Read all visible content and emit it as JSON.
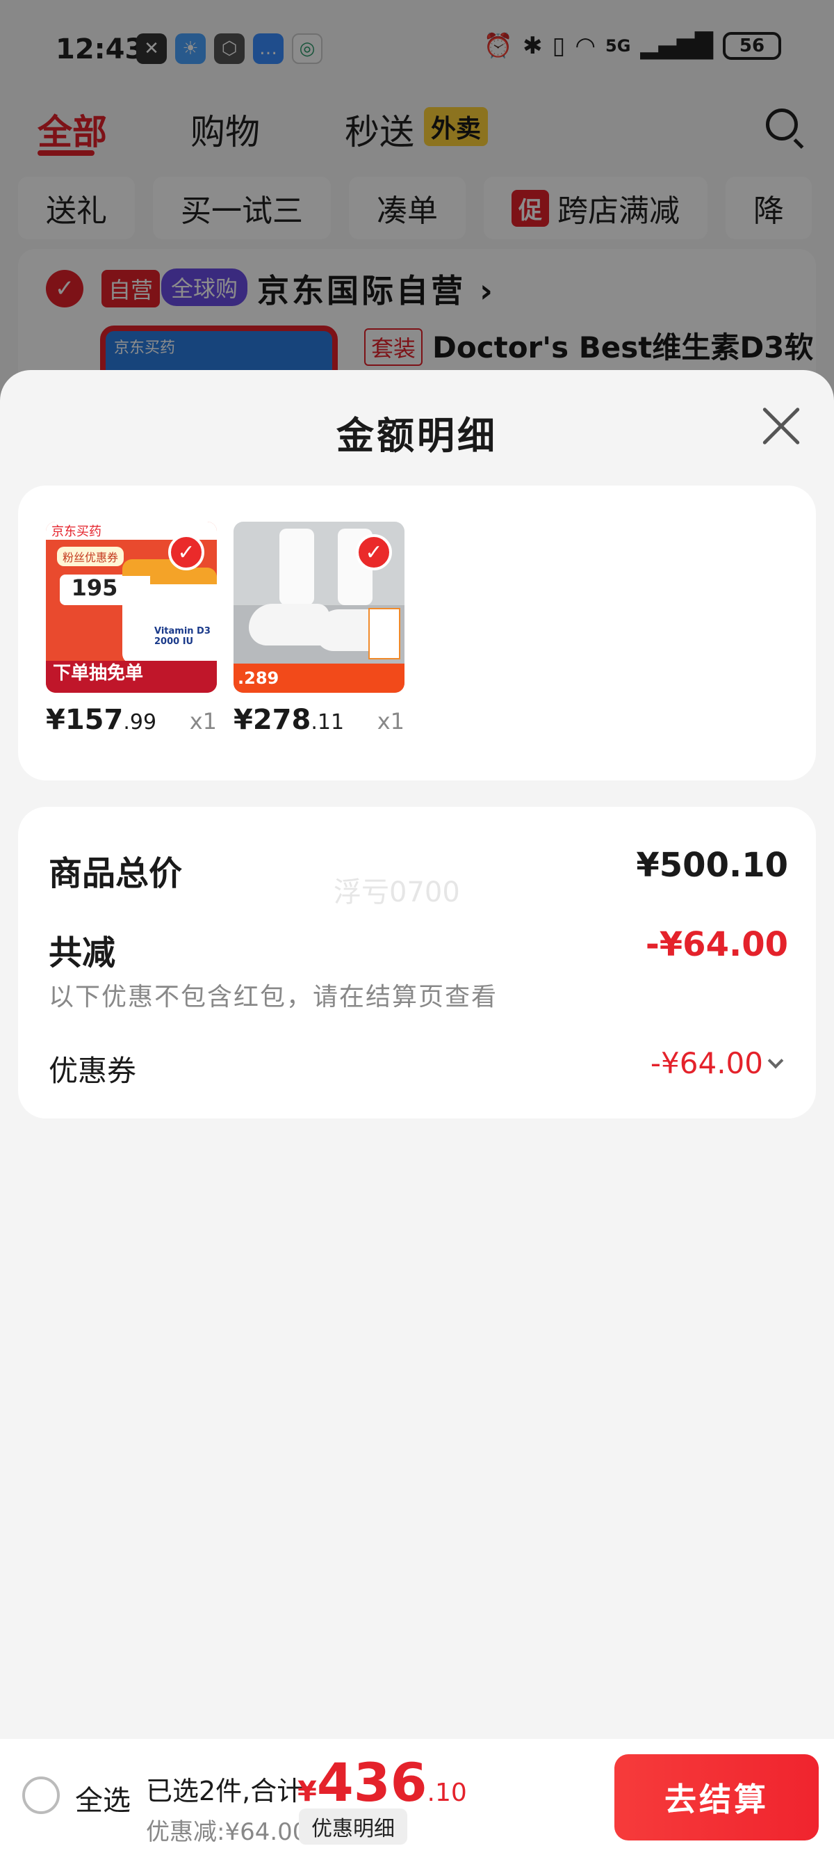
{
  "status_bar": {
    "time": "12:43",
    "network": "5G",
    "battery": "56"
  },
  "top_tabs": [
    {
      "label": "全部",
      "active": true
    },
    {
      "label": "购物",
      "active": false
    },
    {
      "label": "秒送",
      "active": false,
      "badge": "外卖"
    }
  ],
  "filter_chips": [
    {
      "label": "送礼"
    },
    {
      "label": "买一试三"
    },
    {
      "label": "凑单"
    },
    {
      "label": "跨店满减",
      "badge": "促"
    },
    {
      "label": "降"
    }
  ],
  "store": {
    "tag_self": "自营",
    "tag_global": "全球购",
    "name": "京东国际自营",
    "item_tag": "套装",
    "item_title": "Doctor's Best维生素D3软",
    "thumb_label": "京东买药"
  },
  "sheet": {
    "title": "金额明细",
    "products": [
      {
        "name": "vitamin-d3",
        "price_int": "¥157",
        "price_dec": ".99",
        "qty": "x1",
        "image_text": {
          "brand": "京东买药",
          "pill": "粉丝优惠券",
          "price": "195",
          "bottle": "Vitamin D3 2000 IU",
          "banner": "下单抽免单"
        }
      },
      {
        "name": "sneakers",
        "price_int": "¥278",
        "price_dec": ".11",
        "qty": "x1",
        "image_text": {
          "band": ".289"
        }
      }
    ],
    "summary": {
      "total_label": "商品总价",
      "total_value": "¥500.10",
      "reduce_label": "共减",
      "reduce_value": "-¥64.00",
      "note": "以下优惠不包含红包，请在结算页查看",
      "coupon_label": "优惠券",
      "coupon_value": "-¥64.00",
      "watermark": "浮亏0700"
    }
  },
  "bottom_bar": {
    "select_all": "全选",
    "selected_text": "已选2件,合计:",
    "total_currency": "¥",
    "total_int": "436",
    "total_dec": ".10",
    "discount_text": "优惠减:¥64.00",
    "detail_button": "优惠明细",
    "checkout_button": "去结算"
  },
  "colors": {
    "accent": "#e4222b",
    "global_tag": "#6b4de6",
    "waimai_tag": "#ffd23a"
  }
}
